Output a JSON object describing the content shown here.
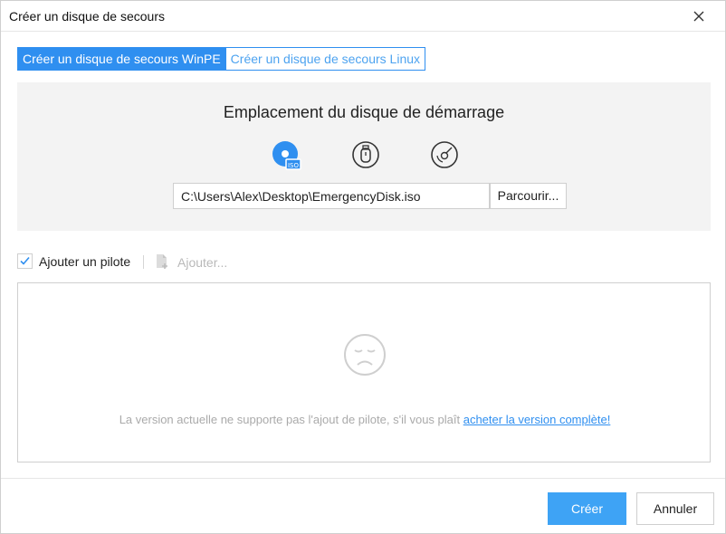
{
  "window": {
    "title": "Créer un disque de secours",
    "close_icon": "close-icon"
  },
  "tabs": [
    {
      "label": "Créer un disque de secours WinPE",
      "active": true
    },
    {
      "label": "Créer un disque de secours Linux",
      "active": false
    }
  ],
  "boot_location": {
    "title": "Emplacement du disque de démarrage",
    "media": [
      {
        "icon": "iso-disc-icon",
        "selected": true
      },
      {
        "icon": "usb-drive-icon",
        "selected": false
      },
      {
        "icon": "cd-dvd-icon",
        "selected": false
      }
    ],
    "path_value": "C:\\Users\\Alex\\Desktop\\EmergencyDisk.iso",
    "browse_label": "Parcourir..."
  },
  "driver": {
    "checkbox_label": "Ajouter un pilote",
    "checked": true,
    "add_label": "Ajouter...",
    "message": "La version actuelle ne supporte pas l'ajout de pilote, s'il vous plaît ",
    "link_text": "acheter la version complète!"
  },
  "footer": {
    "create_label": "Créer",
    "cancel_label": "Annuler"
  },
  "colors": {
    "accent": "#2f8ff0",
    "primary_button": "#3ea3f5",
    "panel_bg": "#f3f3f3",
    "disabled_text": "#b9b9b9"
  }
}
